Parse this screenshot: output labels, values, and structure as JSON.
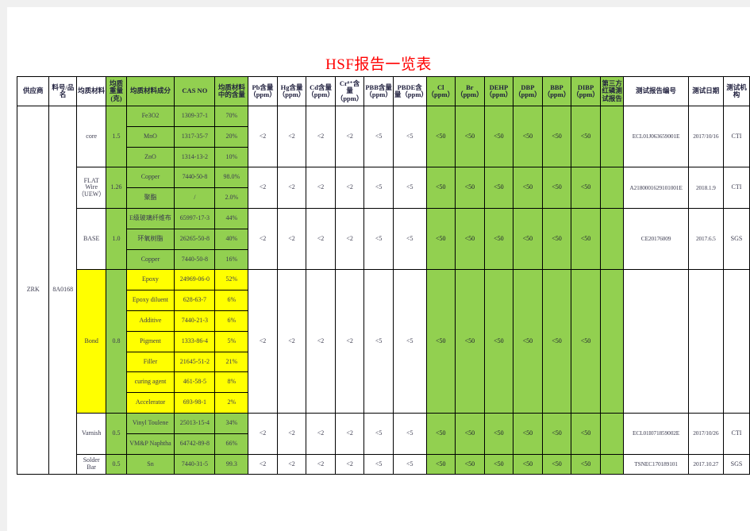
{
  "document": {
    "title": "HSF报告一览表",
    "title_color": "#ff0000"
  },
  "colors": {
    "green_fill": "#92d050",
    "yellow_fill": "#ffff00",
    "white_fill": "#ffffff",
    "grid_line": "#000000"
  },
  "table": {
    "headers": [
      "供应商",
      "料号/品名",
      "均质材料",
      "均质重量(克)",
      "均质材料成分",
      "CAS NO",
      "均质材料中的含量",
      "Pb含量（ppm）",
      "Hg含量（ppm）",
      "Cd含量（ppm）",
      "Cr⁶⁺含量（ppm）",
      "PBB含量（ppm）",
      "PBDE含量（ppm）",
      "Cl（ppm）",
      "Br（ppm）",
      "DEHP（ppm）",
      "DBP（ppm）",
      "BBP（ppm）",
      "DIBP（ppm）",
      "第三方红磷测试报告",
      "测试报告编号",
      "测试日期",
      "测试机构"
    ],
    "supplier": "ZRK",
    "part_number": "8A0168",
    "groups": [
      {
        "material": "core",
        "weight": "1.5",
        "fill": "green",
        "components": [
          {
            "name": "Fe3O2",
            "cas": "1309-37-1",
            "content": "70%"
          },
          {
            "name": "MnO",
            "cas": "1317-35-7",
            "content": "20%"
          },
          {
            "name": "ZnO",
            "cas": "1314-13-2",
            "content": "10%"
          }
        ],
        "pb": "<2",
        "hg": "<2",
        "cd": "<2",
        "cr6": "<2",
        "pbb": "<5",
        "pbde": "<5",
        "cl": "<50",
        "br": "<50",
        "dehp": "<50",
        "dbp": "<50",
        "bbp": "<50",
        "dibp": "<50",
        "third_party_rp": "",
        "report_no": "ECL01J063659001E",
        "test_date": "2017/10/16",
        "test_org": "CTI"
      },
      {
        "material": "FLAT Wire（UEW）",
        "weight": "1.26",
        "fill": "green",
        "components": [
          {
            "name": "Copper",
            "cas": "7440-50-8",
            "content": "98.0%"
          },
          {
            "name": "聚酯",
            "cas": "/",
            "content": "2.0%"
          }
        ],
        "pb": "<2",
        "hg": "<2",
        "cd": "<2",
        "cr6": "<2",
        "pbb": "<5",
        "pbde": "<5",
        "cl": "<50",
        "br": "<50",
        "dehp": "<50",
        "dbp": "<50",
        "bbp": "<50",
        "dibp": "<50",
        "third_party_rp": "",
        "report_no": "A2180001629101001E",
        "test_date": "2018.1.9",
        "test_org": "CTI"
      },
      {
        "material": "BASE",
        "weight": "1.0",
        "fill": "green",
        "components": [
          {
            "name": "E级玻璃纤维布",
            "cas": "65997-17-3",
            "content": "44%"
          },
          {
            "name": "环氧树脂",
            "cas": "26265-50-8",
            "content": "40%"
          },
          {
            "name": "Copper",
            "cas": "7440-50-8",
            "content": "16%"
          }
        ],
        "pb": "<2",
        "hg": "<2",
        "cd": "<2",
        "cr6": "<2",
        "pbb": "<5",
        "pbde": "<5",
        "cl": "<50",
        "br": "<50",
        "dehp": "<50",
        "dbp": "<50",
        "bbp": "<50",
        "dibp": "<50",
        "third_party_rp": "",
        "report_no": "CE20176009",
        "test_date": "2017.6.5",
        "test_org": "SGS"
      },
      {
        "material": "Bond",
        "weight": "0.8",
        "fill": "yellow",
        "components": [
          {
            "name": "Epoxy",
            "cas": "24969-06-0",
            "content": "52%"
          },
          {
            "name": "Epoxy diluent",
            "cas": "628-63-7",
            "content": "6%"
          },
          {
            "name": "Additive",
            "cas": "7440-21-3",
            "content": "6%"
          },
          {
            "name": "Pigment",
            "cas": "1333-86-4",
            "content": "5%"
          },
          {
            "name": "Filler",
            "cas": "21645-51-2",
            "content": "21%"
          },
          {
            "name": "curing agent",
            "cas": "461-58-5",
            "content": "8%"
          },
          {
            "name": "Accelerator",
            "cas": "693-98-1",
            "content": "2%"
          }
        ],
        "pb": "<2",
        "hg": "<2",
        "cd": "<2",
        "cr6": "<2",
        "pbb": "<5",
        "pbde": "<5",
        "cl": "<50",
        "br": "<50",
        "dehp": "<50",
        "dbp": "<50",
        "bbp": "<50",
        "dibp": "<50",
        "third_party_rp": "",
        "report_no": "",
        "test_date": "",
        "test_org": ""
      },
      {
        "material": "Varnish",
        "weight": "0.5",
        "fill": "green",
        "components": [
          {
            "name": "Vinyl Toulene",
            "cas": "25013-15-4",
            "content": "34%"
          },
          {
            "name": "VM&P Naphtha",
            "cas": "64742-89-8",
            "content": "66%"
          }
        ],
        "pb": "<2",
        "hg": "<2",
        "cd": "<2",
        "cr6": "<2",
        "pbb": "<5",
        "pbde": "<5",
        "cl": "<50",
        "br": "<50",
        "dehp": "<50",
        "dbp": "<50",
        "bbp": "<50",
        "dibp": "<50",
        "third_party_rp": "",
        "report_no": "ECL01I071859002E",
        "test_date": "2017/10/26",
        "test_org": "CTI"
      },
      {
        "material": "Solder Bar",
        "weight": "0.5",
        "fill": "green",
        "components": [
          {
            "name": "Sn",
            "cas": "7440-31-5",
            "content": "99.3"
          }
        ],
        "pb": "<2",
        "hg": "<2",
        "cd": "<2",
        "cr6": "<2",
        "pbb": "<5",
        "pbde": "<5",
        "cl": "<50",
        "br": "<50",
        "dehp": "<50",
        "dbp": "<50",
        "bbp": "<50",
        "dibp": "<50",
        "third_party_rp": "",
        "report_no": "TSNEC170189101",
        "test_date": "2017.10.27",
        "test_org": "SGS"
      }
    ]
  }
}
